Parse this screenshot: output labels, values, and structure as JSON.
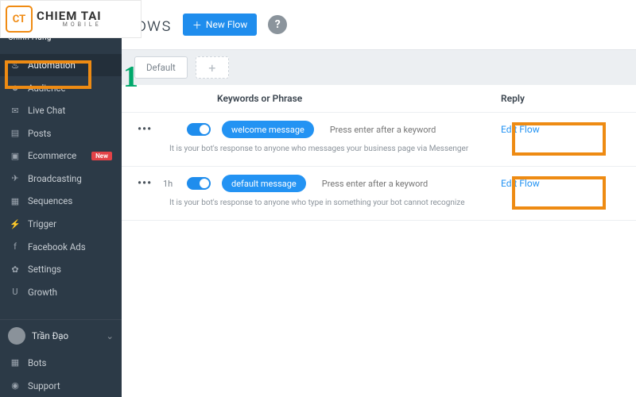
{
  "logo": {
    "mark": "CT",
    "line1": "CHIEM TAI",
    "line2": "MOBILE"
  },
  "sidebar": {
    "brand_sub": "Chính Hãng",
    "items": [
      {
        "label": "Automation",
        "icon": "⚙"
      },
      {
        "label": "Audience",
        "icon": "☺"
      },
      {
        "label": "Live Chat",
        "icon": "💬"
      },
      {
        "label": "Posts",
        "icon": "📄"
      },
      {
        "label": "Ecommerce",
        "icon": "🛒",
        "badge": "New"
      },
      {
        "label": "Broadcasting",
        "icon": "✈"
      },
      {
        "label": "Sequences",
        "icon": "🗓"
      },
      {
        "label": "Trigger",
        "icon": "⚡"
      },
      {
        "label": "Facebook Ads",
        "icon": "f"
      },
      {
        "label": "Settings",
        "icon": "✿"
      },
      {
        "label": "Growth",
        "icon": "🧲"
      }
    ],
    "user": {
      "name": "Trần Đạo"
    },
    "footer": [
      {
        "label": "Bots",
        "icon": "▦"
      },
      {
        "label": "Support",
        "icon": "⦿"
      }
    ]
  },
  "header": {
    "title": "ows",
    "new_flow": "New Flow"
  },
  "tabs": {
    "default": "Default"
  },
  "table": {
    "head_keywords": "Keywords or Phrase",
    "head_reply": "Reply",
    "rows": [
      {
        "time": "",
        "pill": "welcome message",
        "placeholder": "Press enter after a keyword",
        "desc": "It is your bot's response to anyone who messages your business page via Messenger",
        "edit": "Edit Flow"
      },
      {
        "time": "1h",
        "pill": "default message",
        "placeholder": "Press enter after a keyword",
        "desc": "It is your bot's response to anyone who type in something your bot cannot recognize",
        "edit": "Edit Flow"
      }
    ]
  },
  "annot": {
    "num1": "1"
  }
}
